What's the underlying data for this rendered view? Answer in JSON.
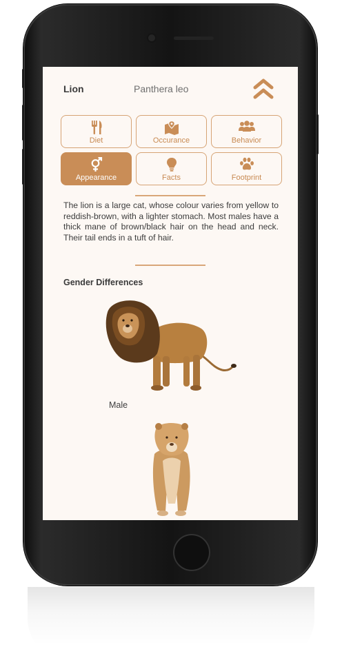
{
  "header": {
    "title": "Lion",
    "scientific_name": "Panthera leo",
    "collapse_icon": "double-chevron-up-icon"
  },
  "tabs": [
    {
      "label": "Diet",
      "icon": "fork-knife-icon",
      "active": false
    },
    {
      "label": "Occurance",
      "icon": "map-pin-icon",
      "active": false
    },
    {
      "label": "Behavior",
      "icon": "group-icon",
      "active": false
    },
    {
      "label": "Appearance",
      "icon": "gender-icon",
      "active": true
    },
    {
      "label": "Facts",
      "icon": "lightbulb-icon",
      "active": false
    },
    {
      "label": "Footprint",
      "icon": "paw-icon",
      "active": false
    }
  ],
  "description": " The lion is a large cat, whose colour varies from yellow to reddish-brown, with a lighter stomach. Most males have a thick mane of brown/black hair on the head and neck. Their tail ends in a tuft of hair.",
  "gender_section": {
    "heading": "Gender Differences",
    "male_caption": "Male"
  },
  "colors": {
    "accent": "#c98d57",
    "accent_border": "#d6a374",
    "background": "#fdf8f4",
    "text": "#3b3b3b"
  }
}
